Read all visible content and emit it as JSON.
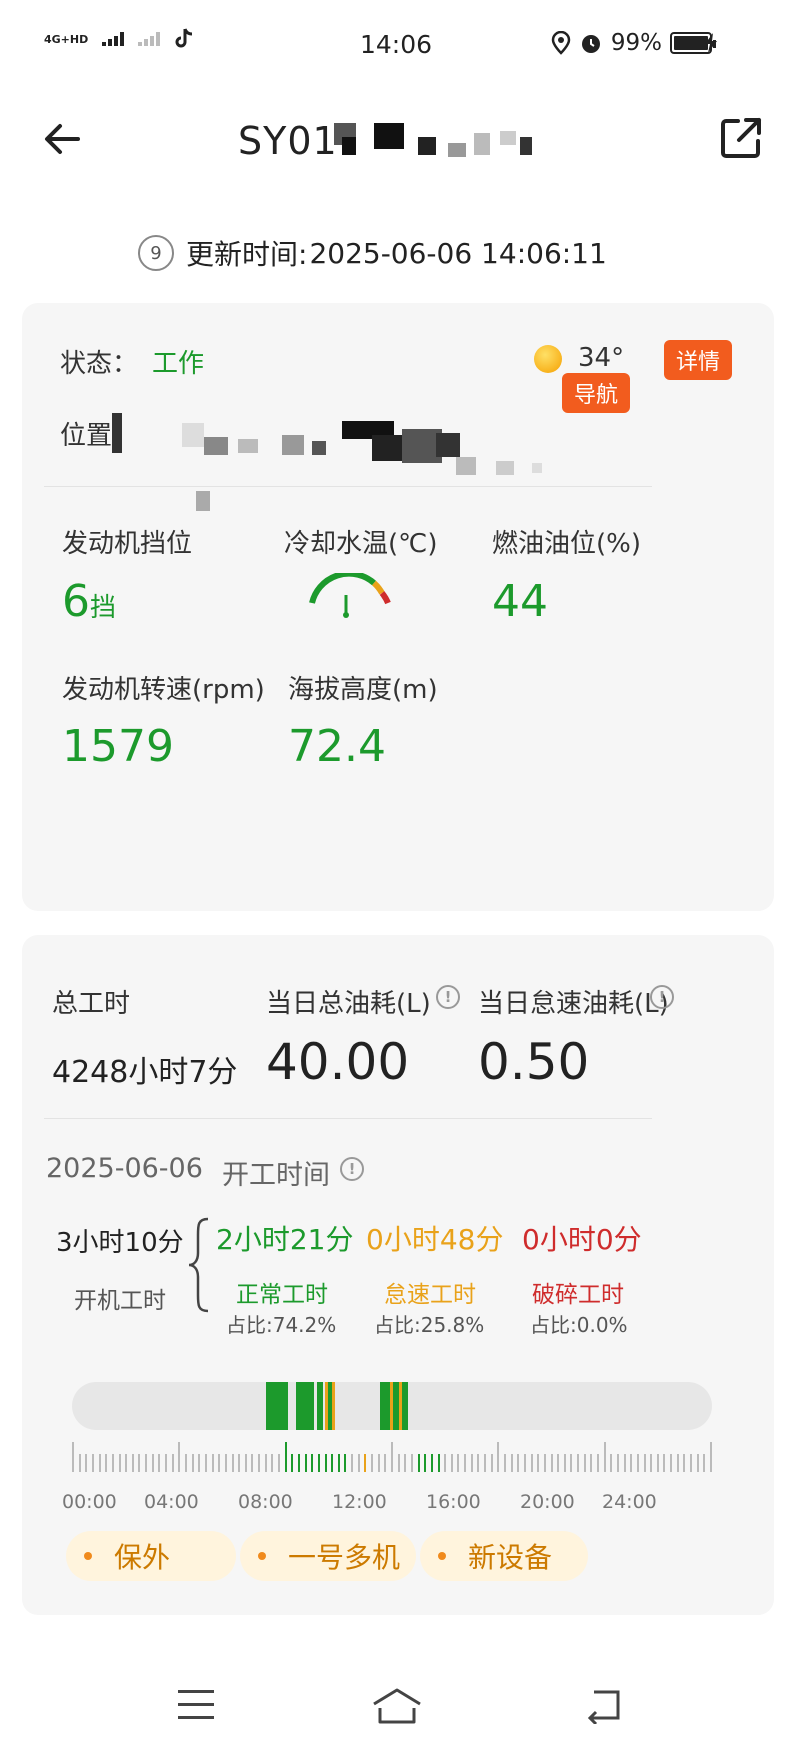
{
  "status_bar": {
    "network": "4G+HD",
    "time": "14:06",
    "battery": "99%"
  },
  "header": {
    "title": "SY01"
  },
  "update": {
    "icon_text": "9",
    "label": "更新时间:",
    "datetime": "2025-06-06 14:06:11"
  },
  "card1": {
    "status_label": "状态：",
    "status_value": "工作",
    "temperature": "34°",
    "detail_button": "详情",
    "location_label": "位置",
    "nav_button": "导航",
    "metrics": {
      "gear_label": "发动机挡位",
      "gear_value": "6",
      "gear_unit": "挡",
      "coolant_label": "冷却水温(℃)",
      "fuel_label": "燃油油位(%)",
      "fuel_value": "44",
      "rpm_label": "发动机转速(rpm)",
      "rpm_value": "1579",
      "altitude_label": "海拔高度(m)",
      "altitude_value": "72.4"
    }
  },
  "card2": {
    "total_hours_label": "总工时",
    "total_hours_value": "4248小时7分",
    "daily_fuel_label": "当日总油耗(L)",
    "daily_fuel_value": "40.00",
    "idle_fuel_label": "当日怠速油耗(L)",
    "idle_fuel_value": "0.50",
    "work_date": "2025-06-06",
    "work_time_label": "开工时间",
    "engine_time_value": "3小时10分",
    "engine_time_label": "开机工时",
    "normal": {
      "value": "2小时21分",
      "label": "正常工时",
      "ratio": "占比:74.2%"
    },
    "idle": {
      "value": "0小时48分",
      "label": "怠速工时",
      "ratio": "占比:25.8%"
    },
    "breaker": {
      "value": "0小时0分",
      "label": "破碎工时",
      "ratio": "占比:0.0%"
    },
    "timeline_hours": [
      "00:00",
      "04:00",
      "08:00",
      "12:00",
      "16:00",
      "20:00",
      "24:00"
    ],
    "tags": [
      "保外",
      "一号多机",
      "新设备"
    ],
    "colors": {
      "normal": "#1c9a2c",
      "idle": "#e9a21a",
      "breaker": "#cf2c2c"
    }
  }
}
